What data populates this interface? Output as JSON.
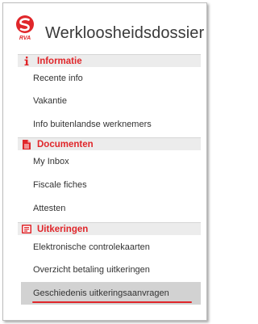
{
  "header": {
    "title": "Werkloosheidsdossier",
    "logo_text": "RVA"
  },
  "colors": {
    "accent": "#e0262a",
    "section_bg": "#ececec",
    "active_bg": "#d2d2d2"
  },
  "sections": [
    {
      "title": "Informatie",
      "icon": "info-icon",
      "items": [
        "Recente info",
        "Vakantie",
        "Info buitenlandse werknemers"
      ]
    },
    {
      "title": "Documenten",
      "icon": "document-icon",
      "items": [
        "My Inbox",
        "Fiscale fiches",
        "Attesten"
      ]
    },
    {
      "title": "Uitkeringen",
      "icon": "benefits-icon",
      "items": [
        "Elektronische controlekaarten",
        "Overzicht betaling uitkeringen",
        "Geschiedenis uitkeringsaanvragen"
      ]
    }
  ],
  "active_item": "Geschiedenis uitkeringsaanvragen"
}
